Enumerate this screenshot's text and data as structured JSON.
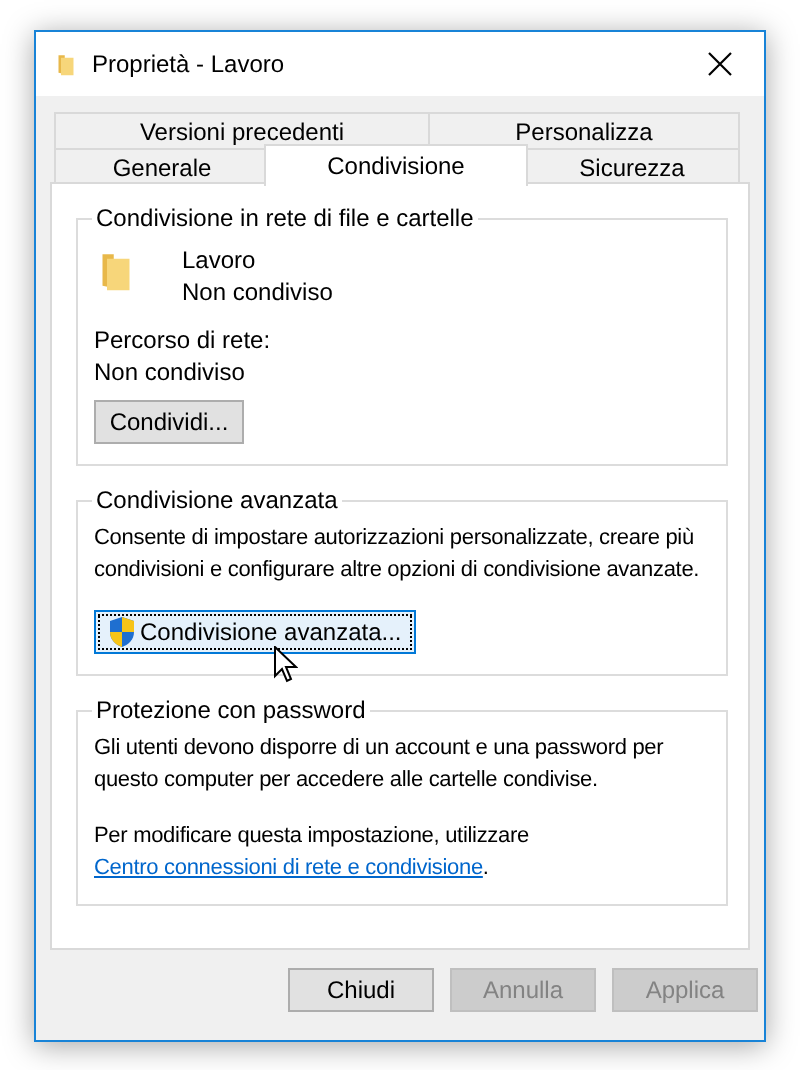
{
  "window": {
    "title": "Proprietà - Lavoro"
  },
  "tab_rows": [
    {
      "tabs": [
        {
          "label": "Versioni precedenti",
          "selected": false
        },
        {
          "label": "Personalizza",
          "selected": false
        }
      ]
    },
    {
      "tabs": [
        {
          "label": "Generale",
          "selected": false
        },
        {
          "label": "Condivisione",
          "selected": true
        },
        {
          "label": "Sicurezza",
          "selected": false
        }
      ]
    }
  ],
  "network_sharing": {
    "title": "Condivisione in rete di file e cartelle",
    "folder_name": "Lavoro",
    "folder_status": "Non condiviso",
    "path_label": "Percorso di rete:",
    "path_value": "Non condiviso",
    "button": {
      "label": "Condividi...",
      "focused": false
    }
  },
  "advanced_sharing": {
    "title": "Condivisione avanzata",
    "description": "Consente di impostare autorizzazioni personalizzate, creare più condivisioni e configurare altre opzioni di condivisione avanzate.",
    "button": {
      "label": "Condivisione avanzata...",
      "focused": true
    }
  },
  "password_protection": {
    "title": "Protezione con password",
    "description": "Gli utenti devono disporre di un account e una password per questo computer per accedere alle cartelle condivise.",
    "note": "Per modificare questa impostazione, utilizzare",
    "link": "Centro connessioni di rete e condivisione",
    "note_end": "."
  },
  "buttons": [
    {
      "label": "Chiudi",
      "disabled": false
    },
    {
      "label": "Annulla",
      "disabled": true
    },
    {
      "label": "Applica",
      "disabled": true
    }
  ]
}
